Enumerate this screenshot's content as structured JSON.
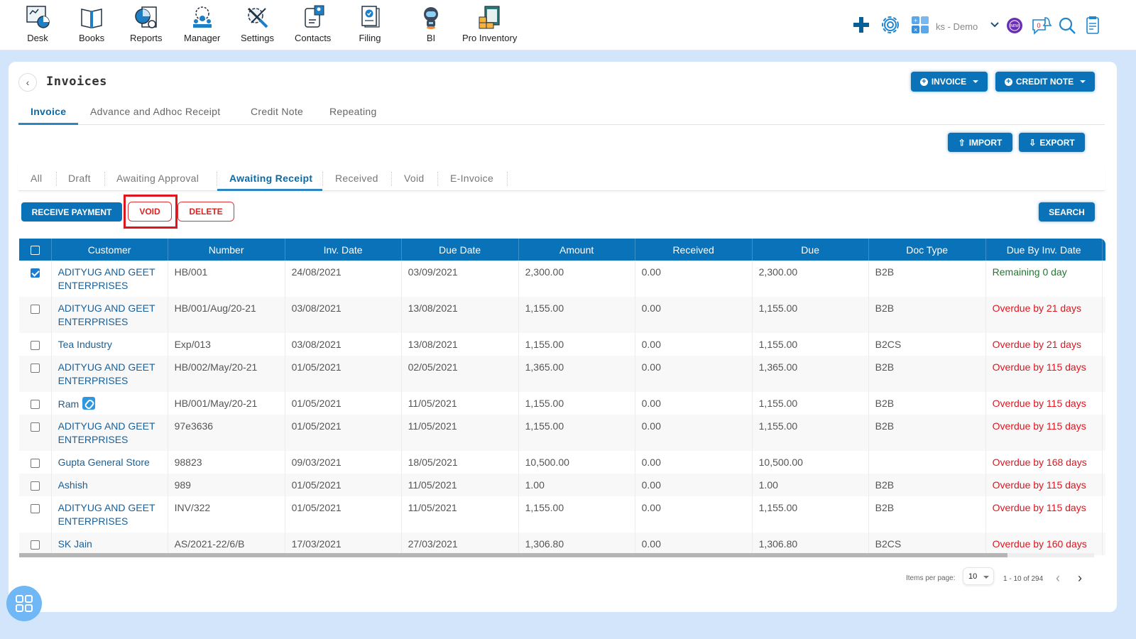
{
  "nav": {
    "items": [
      {
        "label": "Desk",
        "icon": "desk-icon"
      },
      {
        "label": "Books",
        "icon": "books-icon"
      },
      {
        "label": "Reports",
        "icon": "reports-icon"
      },
      {
        "label": "Manager",
        "icon": "manager-icon"
      },
      {
        "label": "Settings",
        "icon": "settings-tools-icon"
      },
      {
        "label": "Contacts",
        "icon": "contacts-icon"
      },
      {
        "label": "Filing",
        "icon": "filing-icon"
      },
      {
        "label": "BI",
        "icon": "bi-robot-icon"
      },
      {
        "label": "Pro Inventory",
        "icon": "pro-inventory-icon"
      }
    ],
    "company": "ks - Demo",
    "notification_count": "0",
    "new_badge": "NEW"
  },
  "page": {
    "title": "Invoices",
    "invoice_button": "INVOICE",
    "credit_note_button": "CREDIT NOTE",
    "import_button": "IMPORT",
    "export_button": "EXPORT"
  },
  "main_tabs": [
    "Invoice",
    "Advance and Adhoc Receipt",
    "Credit Note",
    "Repeating"
  ],
  "active_main_tab": "Invoice",
  "status_tabs": [
    "All",
    "Draft",
    "Awaiting Approval",
    "Awaiting Receipt",
    "Received",
    "Void",
    "E-Invoice"
  ],
  "active_status_tab": "Awaiting Receipt",
  "actions": {
    "receive_payment": "RECEIVE PAYMENT",
    "void": "VOID",
    "delete": "DELETE",
    "search": "SEARCH"
  },
  "table": {
    "columns": [
      "Customer",
      "Number",
      "Inv. Date",
      "Due Date",
      "Amount",
      "Received",
      "Due",
      "Doc Type",
      "Due By Inv. Date",
      ""
    ],
    "rows": [
      {
        "checked": true,
        "customer": "ADITYUG AND GEET ENTERPRISES",
        "number": "HB/001",
        "inv_date": "24/08/2021",
        "due_date": "03/09/2021",
        "amount": "2,300.00",
        "received": "0.00",
        "due": "2,300.00",
        "doc_type": "B2B",
        "due_by_inv": "Remaining 0 day",
        "status": "ok",
        "extra": "Re"
      },
      {
        "checked": false,
        "customer": "ADITYUG AND GEET ENTERPRISES",
        "number": "HB/001/Aug/20-21",
        "inv_date": "03/08/2021",
        "due_date": "13/08/2021",
        "amount": "1,155.00",
        "received": "0.00",
        "due": "1,155.00",
        "doc_type": "B2B",
        "due_by_inv": "Overdue by 21 days",
        "status": "overdue",
        "extra": "Ov"
      },
      {
        "checked": false,
        "customer": "Tea Industry",
        "number": "Exp/013",
        "inv_date": "03/08/2021",
        "due_date": "13/08/2021",
        "amount": "1,155.00",
        "received": "0.00",
        "due": "1,155.00",
        "doc_type": "B2CS",
        "due_by_inv": "Overdue by 21 days",
        "status": "overdue",
        "extra": "Ov"
      },
      {
        "checked": false,
        "customer": "ADITYUG AND GEET ENTERPRISES",
        "number": "HB/002/May/20-21",
        "inv_date": "01/05/2021",
        "due_date": "02/05/2021",
        "amount": "1,365.00",
        "received": "0.00",
        "due": "1,365.00",
        "doc_type": "B2B",
        "due_by_inv": "Overdue by 115 days",
        "status": "overdue",
        "extra": "Ov"
      },
      {
        "checked": false,
        "customer": "Ram",
        "attachment": true,
        "number": "HB/001/May/20-21",
        "inv_date": "01/05/2021",
        "due_date": "11/05/2021",
        "amount": "1,155.00",
        "received": "0.00",
        "due": "1,155.00",
        "doc_type": "B2B",
        "due_by_inv": "Overdue by 115 days",
        "status": "overdue",
        "extra": "Ov"
      },
      {
        "checked": false,
        "customer": "ADITYUG AND GEET ENTERPRISES",
        "number": "97e3636",
        "inv_date": "01/05/2021",
        "due_date": "11/05/2021",
        "amount": "1,155.00",
        "received": "0.00",
        "due": "1,155.00",
        "doc_type": "B2B",
        "due_by_inv": "Overdue by 115 days",
        "status": "overdue",
        "extra": "Ov"
      },
      {
        "checked": false,
        "customer": "Gupta General Store",
        "number": "98823",
        "inv_date": "09/03/2021",
        "due_date": "18/05/2021",
        "amount": "10,500.00",
        "received": "0.00",
        "due": "10,500.00",
        "doc_type": "",
        "due_by_inv": "Overdue by 168 days",
        "status": "overdue",
        "extra": "Ov"
      },
      {
        "checked": false,
        "customer": "Ashish",
        "number": "989",
        "inv_date": "01/05/2021",
        "due_date": "11/05/2021",
        "amount": "1.00",
        "received": "0.00",
        "due": "1.00",
        "doc_type": "B2B",
        "due_by_inv": "Overdue by 115 days",
        "status": "overdue",
        "extra": "Ov"
      },
      {
        "checked": false,
        "customer": "ADITYUG AND GEET ENTERPRISES",
        "number": "INV/322",
        "inv_date": "01/05/2021",
        "due_date": "11/05/2021",
        "amount": "1,155.00",
        "received": "0.00",
        "due": "1,155.00",
        "doc_type": "B2B",
        "due_by_inv": "Overdue by 115 days",
        "status": "overdue",
        "extra": "Ov"
      },
      {
        "checked": false,
        "customer": "SK Jain",
        "number": "AS/2021-22/6/B",
        "inv_date": "17/03/2021",
        "due_date": "27/03/2021",
        "amount": "1,306.80",
        "received": "0.00",
        "due": "1,306.80",
        "doc_type": "B2CS",
        "due_by_inv": "Overdue by 160 days",
        "status": "overdue",
        "extra": "Ov"
      }
    ]
  },
  "pagination": {
    "items_per_page_label": "Items per page:",
    "items_per_page": "10",
    "range": "1 - 10 of 294"
  },
  "colors": {
    "primary": "#0a72b8",
    "danger": "#e0141e",
    "success": "#1f7a2e",
    "background": "#d3e5fb"
  }
}
